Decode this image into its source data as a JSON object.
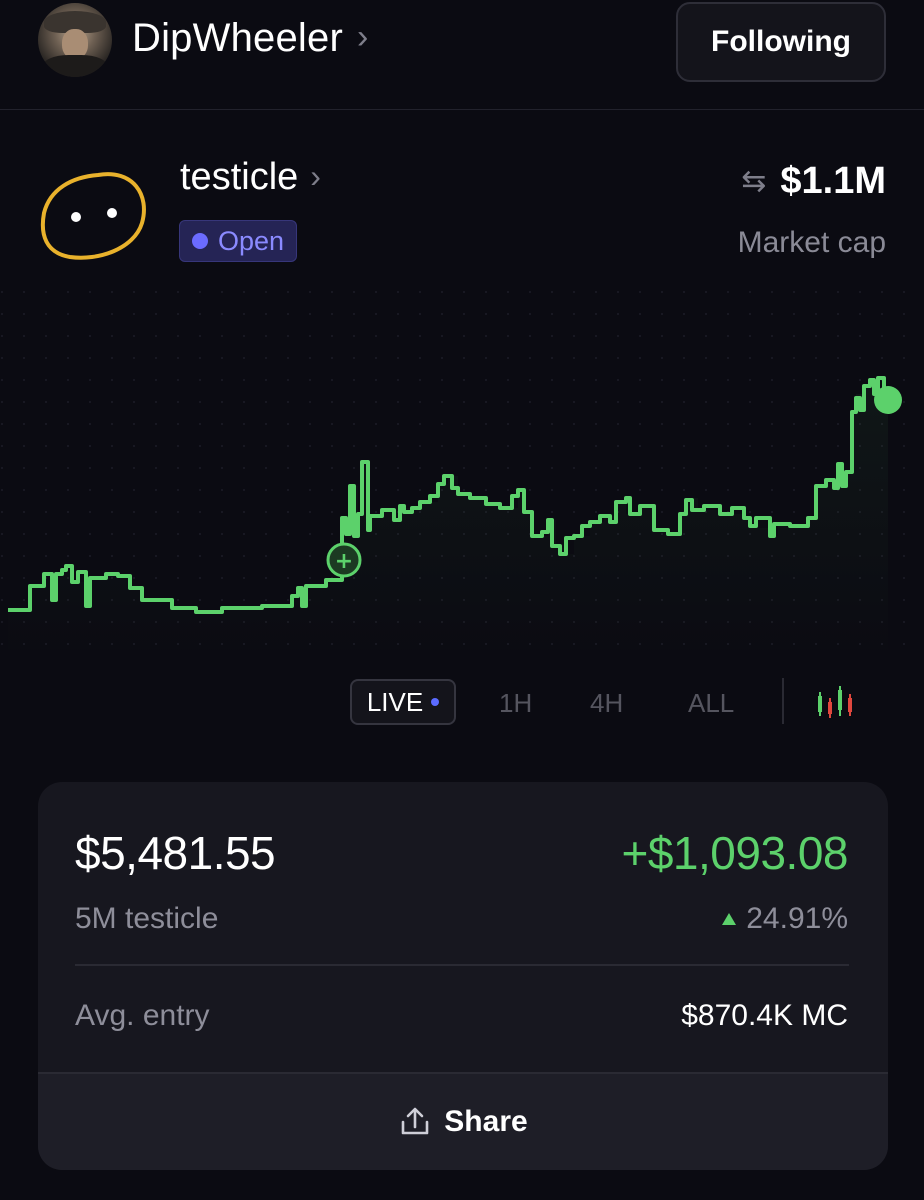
{
  "header": {
    "username": "DipWheeler",
    "username_chevron": "›",
    "follow_button": "Following"
  },
  "token": {
    "name": "testicle",
    "name_chevron": "›",
    "status_badge": "Open",
    "market_cap_value": "$1.1M",
    "market_cap_label": "Market cap",
    "swap_icon": "⇆"
  },
  "chart": {
    "type": "line",
    "color": "#5cd16b",
    "entry_marker": "+"
  },
  "timeframes": {
    "live": "LIVE",
    "options": [
      "1H",
      "4H",
      "ALL"
    ],
    "candle_colors": [
      "#5cd16b",
      "#e0473e"
    ]
  },
  "position": {
    "value": "$5,481.55",
    "pnl": "+$1,093.08",
    "holding": "5M testicle",
    "pnl_percent": "24.91%",
    "avg_entry_label": "Avg. entry",
    "avg_entry_value": "$870.4K MC",
    "share_label": "Share"
  },
  "colors": {
    "background": "#0b0b12",
    "accent_green": "#5cd16b",
    "badge_purple": "#8a8aff",
    "icon_gold": "#e9b22c"
  }
}
